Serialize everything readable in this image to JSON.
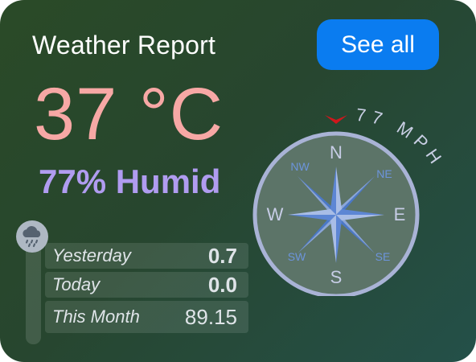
{
  "header": {
    "title": "Weather Report",
    "see_all_label": "See all"
  },
  "current": {
    "temperature": "37 °C",
    "humidity": "77% Humid"
  },
  "rain": {
    "icon": "rain-cloud-icon",
    "rows": [
      {
        "label": "Yesterday",
        "value": "0.7"
      },
      {
        "label": "Today",
        "value": "0.0"
      },
      {
        "label": "This Month",
        "value": "89.15"
      }
    ]
  },
  "wind": {
    "speed_text": "77 MPH",
    "direction_marker_color": "#d0171c",
    "cardinals": {
      "n": "N",
      "e": "E",
      "s": "S",
      "w": "W"
    },
    "intercardinals": {
      "nw": "NW",
      "ne": "NE",
      "sw": "SW",
      "se": "SE"
    }
  },
  "colors": {
    "temperature": "#f7a8a5",
    "humidity": "#b09cf0",
    "button": "#0a7cf0",
    "compass_ring": "#a9b3d6",
    "compass_star": "#4a78c8"
  }
}
